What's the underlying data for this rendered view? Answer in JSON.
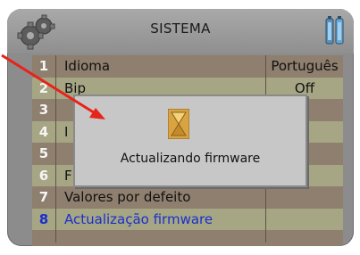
{
  "header": {
    "title": "SISTEMA",
    "icon_left": "gears-icon",
    "icon_right": "battery-icon"
  },
  "menu": {
    "items": [
      {
        "num": "1",
        "label": "Idioma",
        "value": "Português"
      },
      {
        "num": "2",
        "label": "Bip",
        "value": "Off"
      },
      {
        "num": "3",
        "label": "",
        "value": ""
      },
      {
        "num": "4",
        "label": "I",
        "value": ""
      },
      {
        "num": "5",
        "label": "",
        "value": ""
      },
      {
        "num": "6",
        "label": "F",
        "value": ""
      },
      {
        "num": "7",
        "label": "Valores por defeito",
        "value": ""
      },
      {
        "num": "8",
        "label": "Actualização firmware",
        "value": ""
      }
    ],
    "selected_index": 8
  },
  "dialog": {
    "message": "Actualizando firmware",
    "icon": "hourglass-icon"
  },
  "colors": {
    "row_odd": "#8f7f6e",
    "row_even": "#a6a684",
    "selected_text": "#1a2fcc",
    "annotation_arrow": "#e8231a"
  }
}
